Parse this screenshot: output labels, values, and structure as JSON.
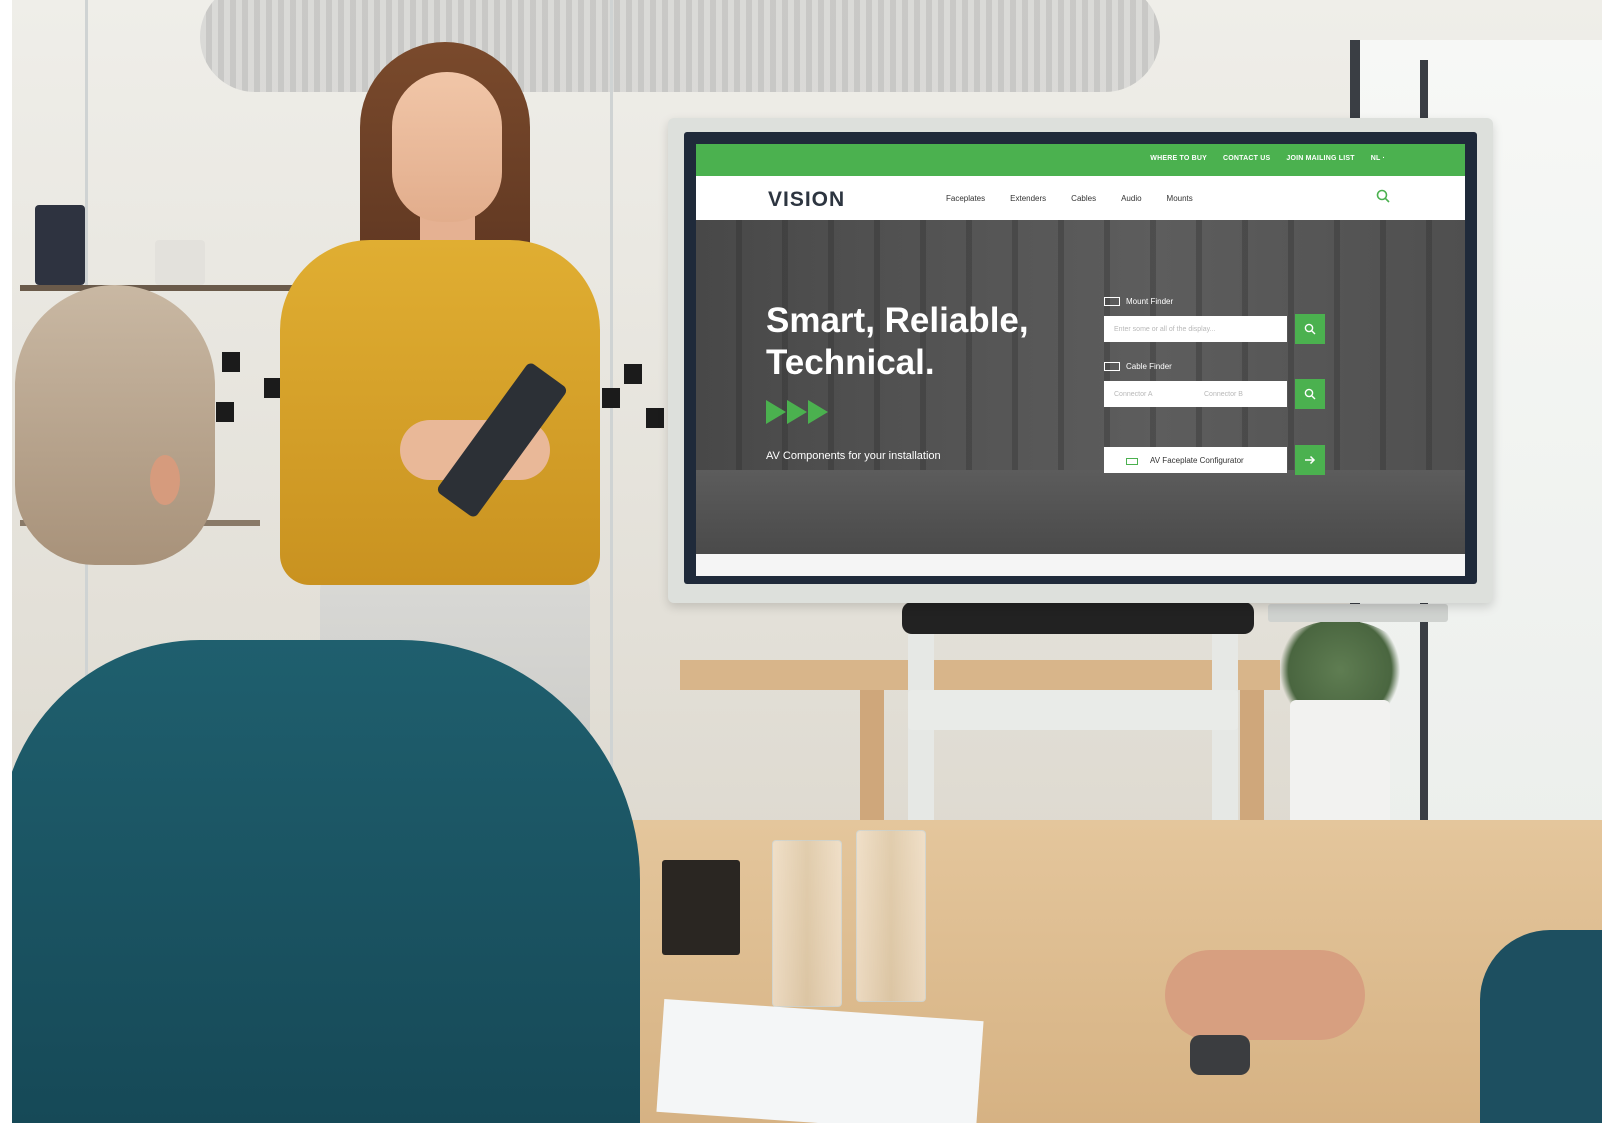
{
  "website": {
    "top_links": [
      "WHERE TO BUY",
      "CONTACT US",
      "JOIN MAILING LIST",
      "NL ·"
    ],
    "logo": "VISION",
    "nav_items": [
      "Faceplates",
      "Extenders",
      "Cables",
      "Audio",
      "Mounts"
    ],
    "hero": {
      "title": "Smart, Reliable, Technical.",
      "subtitle": "AV Components for your installation"
    },
    "mount_finder": {
      "label": "Mount Finder",
      "placeholder": "Enter some or all of the display..."
    },
    "cable_finder": {
      "label": "Cable Finder",
      "connector_a": "Connector A",
      "connector_b": "Connector B"
    },
    "configurator": {
      "label": "AV Faceplate Configurator"
    },
    "colors": {
      "brand_green": "#4bb14f",
      "logo_dark": "#2d3540"
    }
  }
}
